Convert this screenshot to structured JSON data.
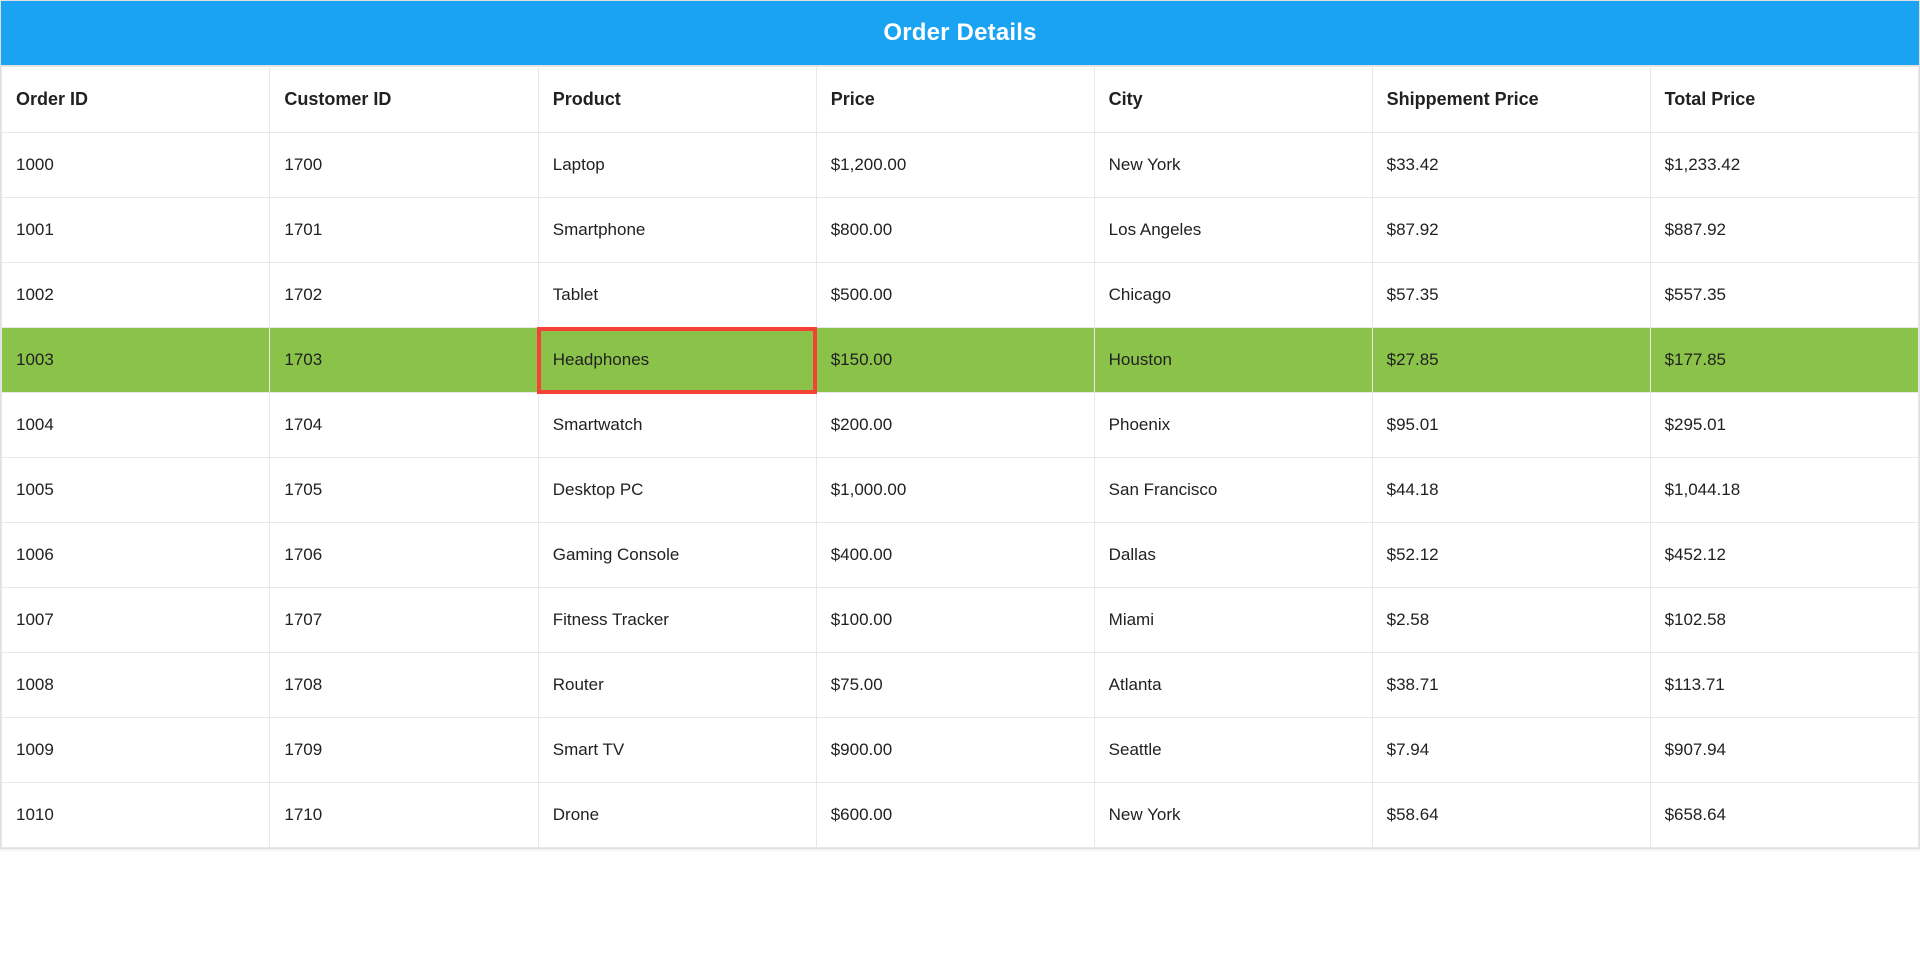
{
  "header": {
    "title": "Order Details"
  },
  "table": {
    "columns": [
      {
        "key": "orderId",
        "label": "Order ID"
      },
      {
        "key": "customerId",
        "label": "Customer ID"
      },
      {
        "key": "product",
        "label": "Product"
      },
      {
        "key": "price",
        "label": "Price"
      },
      {
        "key": "city",
        "label": "City"
      },
      {
        "key": "shipment",
        "label": "Shippement Price"
      },
      {
        "key": "total",
        "label": "Total Price"
      }
    ],
    "highlightedRowIndex": 3,
    "highlightedCellColumnKey": "product",
    "rows": [
      {
        "orderId": "1000",
        "customerId": "1700",
        "product": "Laptop",
        "price": "$1,200.00",
        "city": "New York",
        "shipment": "$33.42",
        "total": "$1,233.42"
      },
      {
        "orderId": "1001",
        "customerId": "1701",
        "product": "Smartphone",
        "price": "$800.00",
        "city": "Los Angeles",
        "shipment": "$87.92",
        "total": "$887.92"
      },
      {
        "orderId": "1002",
        "customerId": "1702",
        "product": "Tablet",
        "price": "$500.00",
        "city": "Chicago",
        "shipment": "$57.35",
        "total": "$557.35"
      },
      {
        "orderId": "1003",
        "customerId": "1703",
        "product": "Headphones",
        "price": "$150.00",
        "city": "Houston",
        "shipment": "$27.85",
        "total": "$177.85"
      },
      {
        "orderId": "1004",
        "customerId": "1704",
        "product": "Smartwatch",
        "price": "$200.00",
        "city": "Phoenix",
        "shipment": "$95.01",
        "total": "$295.01"
      },
      {
        "orderId": "1005",
        "customerId": "1705",
        "product": "Desktop PC",
        "price": "$1,000.00",
        "city": "San Francisco",
        "shipment": "$44.18",
        "total": "$1,044.18"
      },
      {
        "orderId": "1006",
        "customerId": "1706",
        "product": "Gaming Console",
        "price": "$400.00",
        "city": "Dallas",
        "shipment": "$52.12",
        "total": "$452.12"
      },
      {
        "orderId": "1007",
        "customerId": "1707",
        "product": "Fitness Tracker",
        "price": "$100.00",
        "city": "Miami",
        "shipment": "$2.58",
        "total": "$102.58"
      },
      {
        "orderId": "1008",
        "customerId": "1708",
        "product": "Router",
        "price": "$75.00",
        "city": "Atlanta",
        "shipment": "$38.71",
        "total": "$113.71"
      },
      {
        "orderId": "1009",
        "customerId": "1709",
        "product": "Smart TV",
        "price": "$900.00",
        "city": "Seattle",
        "shipment": "$7.94",
        "total": "$907.94"
      },
      {
        "orderId": "1010",
        "customerId": "1710",
        "product": "Drone",
        "price": "$600.00",
        "city": "New York",
        "shipment": "$58.64",
        "total": "$658.64"
      }
    ]
  },
  "colors": {
    "headerBar": "#1aa3f2",
    "rowHighlight": "#8bc34a",
    "cellHighlightBorder": "#f44336"
  }
}
